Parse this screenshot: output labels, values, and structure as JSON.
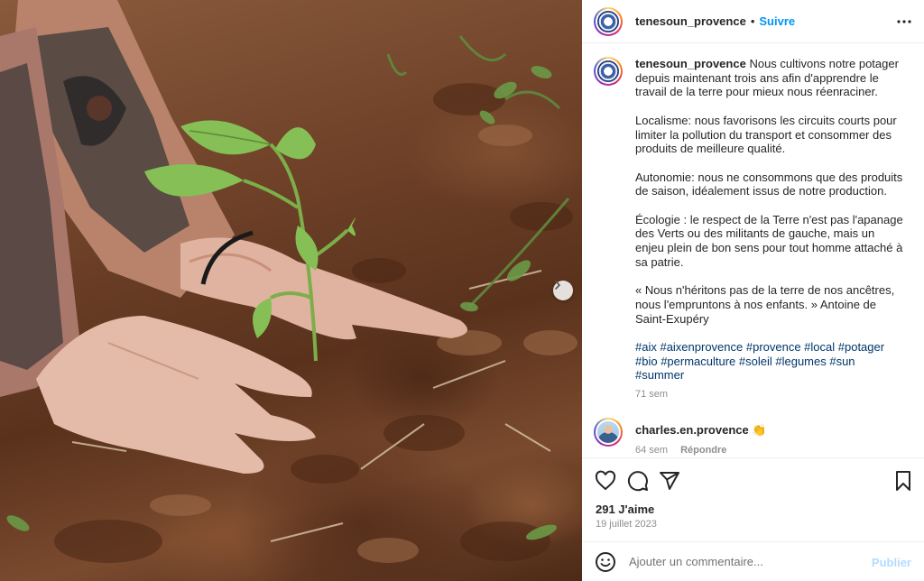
{
  "post": {
    "author": "tenesoun_provence",
    "follow_label": "Suivre",
    "separator": "•",
    "caption": {
      "username": "tenesoun_provence",
      "paragraphs": [
        "Nous cultivons notre potager depuis maintenant trois ans afin d'apprendre le travail de la terre pour mieux nous réenraciner.",
        "Localisme: nous favorisons les circuits courts pour limiter la pollution du transport et consommer des produits de meilleure qualité.",
        "Autonomie: nous ne consommons que des produits de saison, idéalement issus de notre production.",
        "Écologie : le respect de la Terre n'est pas l'apanage des Verts ou des militants de gauche, mais un enjeu plein de bon sens pour tout homme attaché à sa patrie.",
        "« Nous n'héritons pas de la terre de nos ancêtres, nous l'empruntons à nos enfants. » Antoine de Saint-Exupéry"
      ],
      "hashtags": "#aix #aixenprovence #provence #local #potager #bio #permaculture #soleil #legumes #sun #summer",
      "time": "71 sem"
    },
    "comment": {
      "username": "charles.en.provence",
      "text": "👏",
      "time": "64 sem",
      "reply_label": "Répondre"
    },
    "likes": "291 J'aime",
    "date": "19 juillet 2023",
    "add_comment": {
      "placeholder": "Ajouter un commentaire...",
      "publish_label": "Publier"
    }
  },
  "icons": {
    "more": "more-horizontal-icon",
    "like": "heart-icon",
    "comment": "comment-bubble-icon",
    "share": "paper-plane-icon",
    "save": "bookmark-icon",
    "emoji": "emoji-icon",
    "next": "chevron-right-icon"
  },
  "colors": {
    "link_blue": "#0095f6",
    "hashtag": "#00376b",
    "muted": "#8e8e8e",
    "publish_disabled": "#b3dbff"
  }
}
